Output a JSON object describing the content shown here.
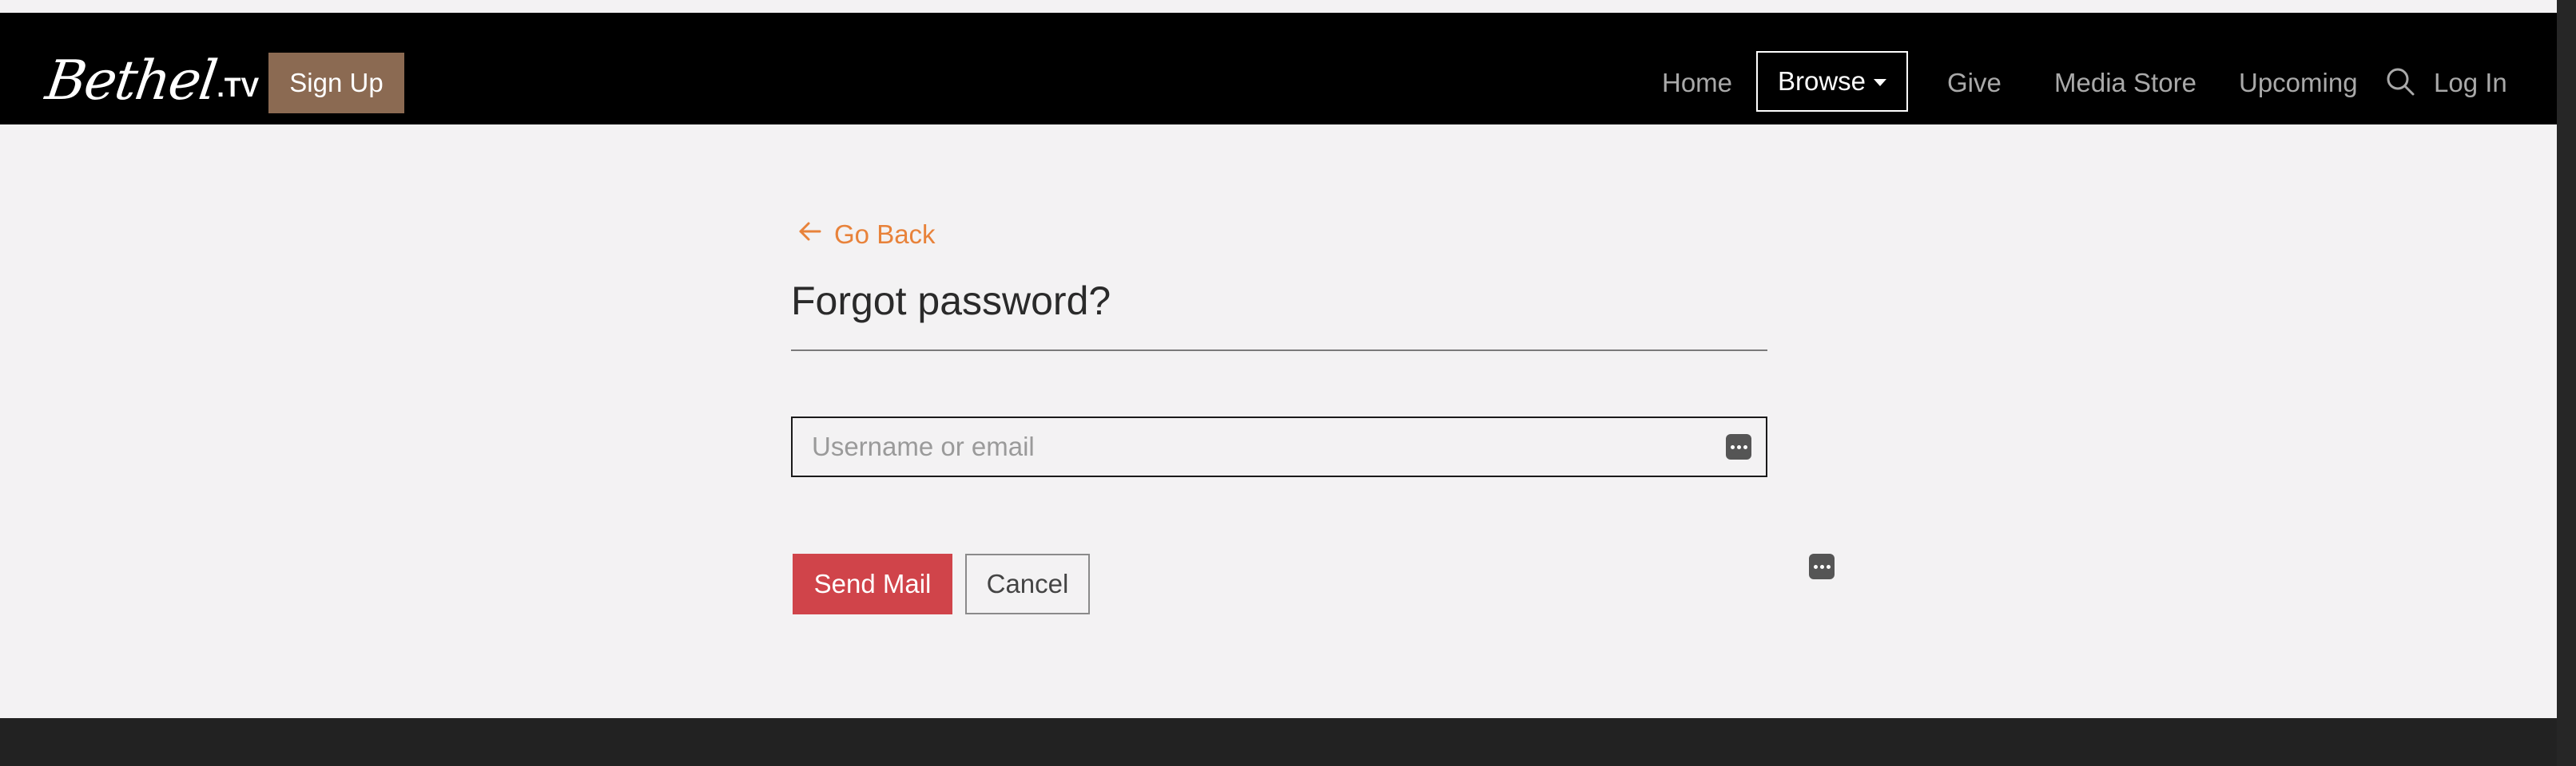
{
  "brand": {
    "logo_script": "Bethel",
    "logo_suffix": ".TV"
  },
  "header": {
    "signup_label": "Sign Up",
    "nav": {
      "home": "Home",
      "browse": "Browse",
      "give": "Give",
      "media_store": "Media Store",
      "upcoming": "Upcoming",
      "login": "Log In"
    },
    "icons": {
      "search": "search-icon",
      "browse_caret": "caret-down-icon"
    }
  },
  "form": {
    "back_label": "Go Back",
    "back_icon": "arrow-left-icon",
    "title": "Forgot password?",
    "field_placeholder": "Username or email",
    "field_value": "",
    "send_label": "Send Mail",
    "cancel_label": "Cancel"
  },
  "colors": {
    "accent_orange": "#e8823a",
    "signup_brown": "#8b6a52",
    "send_red": "#d0444a",
    "navbar": "#000000",
    "page_bg": "#f3f2f3"
  }
}
